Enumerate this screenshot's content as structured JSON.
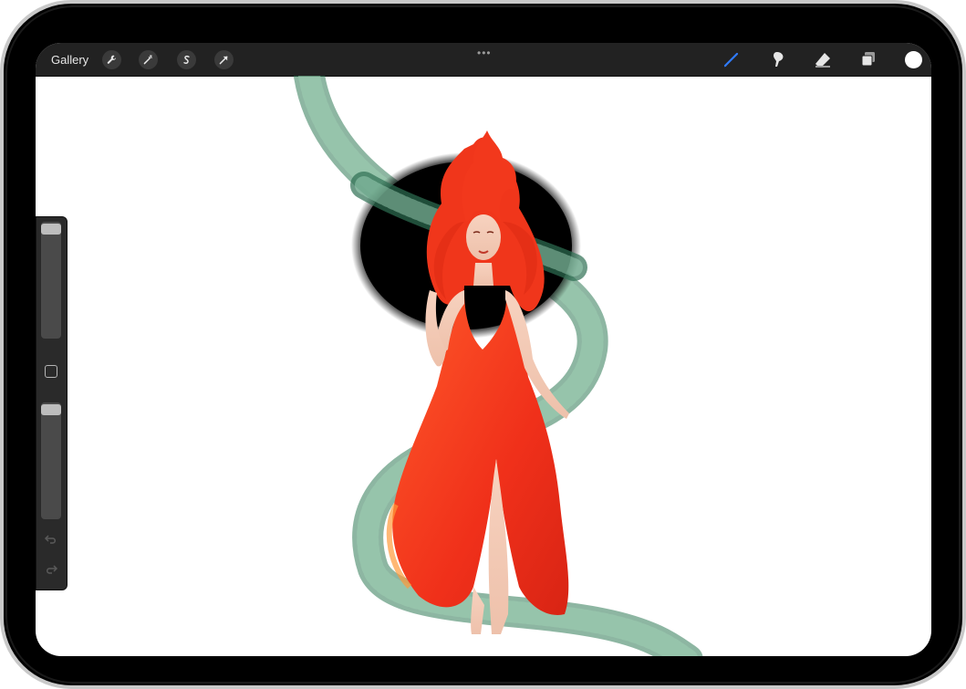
{
  "toolbar": {
    "gallery_label": "Gallery",
    "actions_icon": "wrench-icon",
    "adjustments_icon": "magic-wand-icon",
    "selection_icon": "selection-s-icon",
    "transform_icon": "arrow-cursor-icon",
    "more_label": "•••",
    "brush_icon": "brush-icon",
    "smudge_icon": "smudge-icon",
    "eraser_icon": "eraser-icon",
    "layers_icon": "layers-icon",
    "active_color": "#ffffff",
    "brush_active_color": "#2f7bff"
  },
  "sidebar": {
    "brush_size": 0.02,
    "opacity": 0.02,
    "modify_icon": "square-icon",
    "undo_icon": "undo-icon",
    "redo_icon": "redo-icon"
  },
  "canvas": {
    "background": "#ffffff",
    "artwork": "red-haired-woman-illustration"
  }
}
